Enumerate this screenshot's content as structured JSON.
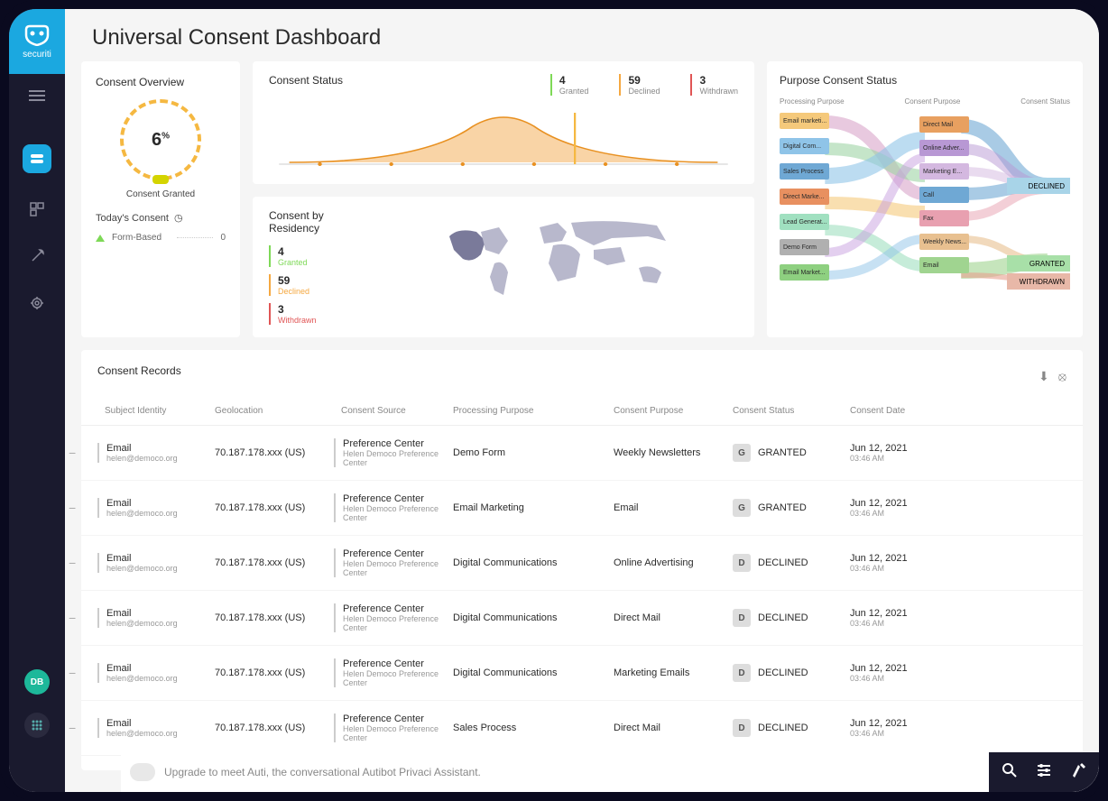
{
  "brand": "securiti",
  "page_title": "Universal Consent Dashboard",
  "avatar": "DB",
  "overview": {
    "title": "Consent Overview",
    "value": "6",
    "percent": "%",
    "label": "Consent Granted",
    "today_label": "Today's Consent",
    "form_based": "Form-Based",
    "form_based_val": "0"
  },
  "status": {
    "title": "Consent Status",
    "granted_val": "4",
    "granted_label": "Granted",
    "declined_val": "59",
    "declined_label": "Declined",
    "withdrawn_val": "3",
    "withdrawn_label": "Withdrawn"
  },
  "residency": {
    "title": "Consent by Residency",
    "granted_val": "4",
    "granted_label": "Granted",
    "declined_val": "59",
    "declined_label": "Declined",
    "withdrawn_val": "3",
    "withdrawn_label": "Withdrawn"
  },
  "sankey": {
    "title": "Purpose Consent Status",
    "h1": "Processing Purpose",
    "h2": "Consent Purpose",
    "h3": "Consent Status",
    "left": [
      "Email marketi...",
      "Digital Com...",
      "Sales Process",
      "Direct Marke...",
      "Lead Generat...",
      "Demo Form",
      "Email Market..."
    ],
    "mid": [
      "Direct Mail",
      "Online Adver...",
      "Marketing E...",
      "Call",
      "Fax",
      "Weekly News...",
      "Email"
    ],
    "right": [
      "DECLINED",
      "GRANTED",
      "WITHDRAWN"
    ]
  },
  "records": {
    "title": "Consent Records",
    "headers": {
      "identity": "Subject Identity",
      "geo": "Geolocation",
      "source": "Consent Source",
      "purpose": "Processing Purpose",
      "cpurpose": "Consent Purpose",
      "status": "Consent Status",
      "date": "Consent Date"
    },
    "rows": [
      {
        "identity": "Email",
        "identity2": "helen@democo.org",
        "geo": "70.187.178.xxx (US)",
        "source": "Preference Center",
        "source2": "Helen Democo Preference Center",
        "purpose": "Demo Form",
        "cpurpose": "Weekly Newsletters",
        "status_code": "G",
        "status": "GRANTED",
        "date": "Jun 12, 2021",
        "time": "03:46 AM"
      },
      {
        "identity": "Email",
        "identity2": "helen@democo.org",
        "geo": "70.187.178.xxx (US)",
        "source": "Preference Center",
        "source2": "Helen Democo Preference Center",
        "purpose": "Email Marketing",
        "cpurpose": "Email",
        "status_code": "G",
        "status": "GRANTED",
        "date": "Jun 12, 2021",
        "time": "03:46 AM"
      },
      {
        "identity": "Email",
        "identity2": "helen@democo.org",
        "geo": "70.187.178.xxx (US)",
        "source": "Preference Center",
        "source2": "Helen Democo Preference Center",
        "purpose": "Digital Communications",
        "cpurpose": "Online Advertising",
        "status_code": "D",
        "status": "DECLINED",
        "date": "Jun 12, 2021",
        "time": "03:46 AM"
      },
      {
        "identity": "Email",
        "identity2": "helen@democo.org",
        "geo": "70.187.178.xxx (US)",
        "source": "Preference Center",
        "source2": "Helen Democo Preference Center",
        "purpose": "Digital Communications",
        "cpurpose": "Direct Mail",
        "status_code": "D",
        "status": "DECLINED",
        "date": "Jun 12, 2021",
        "time": "03:46 AM"
      },
      {
        "identity": "Email",
        "identity2": "helen@democo.org",
        "geo": "70.187.178.xxx (US)",
        "source": "Preference Center",
        "source2": "Helen Democo Preference Center",
        "purpose": "Digital Communications",
        "cpurpose": "Marketing Emails",
        "status_code": "D",
        "status": "DECLINED",
        "date": "Jun 12, 2021",
        "time": "03:46 AM"
      },
      {
        "identity": "Email",
        "identity2": "helen@democo.org",
        "geo": "70.187.178.xxx (US)",
        "source": "Preference Center",
        "source2": "Helen Democo Preference Center",
        "purpose": "Sales Process",
        "cpurpose": "Direct Mail",
        "status_code": "D",
        "status": "DECLINED",
        "date": "Jun 12, 2021",
        "time": "03:46 AM"
      }
    ]
  },
  "footer": {
    "upgrade": "Upgrade to meet Auti, the conversational Autibot Privaci Assistant."
  },
  "chart_data": {
    "type": "sankey",
    "title": "Purpose Consent Status",
    "columns": [
      "Processing Purpose",
      "Consent Purpose",
      "Consent Status"
    ],
    "processing_purposes": [
      "Email marketing",
      "Digital Communications",
      "Sales Process",
      "Direct Marketing",
      "Lead Generation",
      "Demo Form",
      "Email Marketing"
    ],
    "consent_purposes": [
      "Direct Mail",
      "Online Advertising",
      "Marketing Emails",
      "Call",
      "Fax",
      "Weekly Newsletters",
      "Email"
    ],
    "consent_status": {
      "DECLINED": 59,
      "GRANTED": 4,
      "WITHDRAWN": 3
    }
  }
}
